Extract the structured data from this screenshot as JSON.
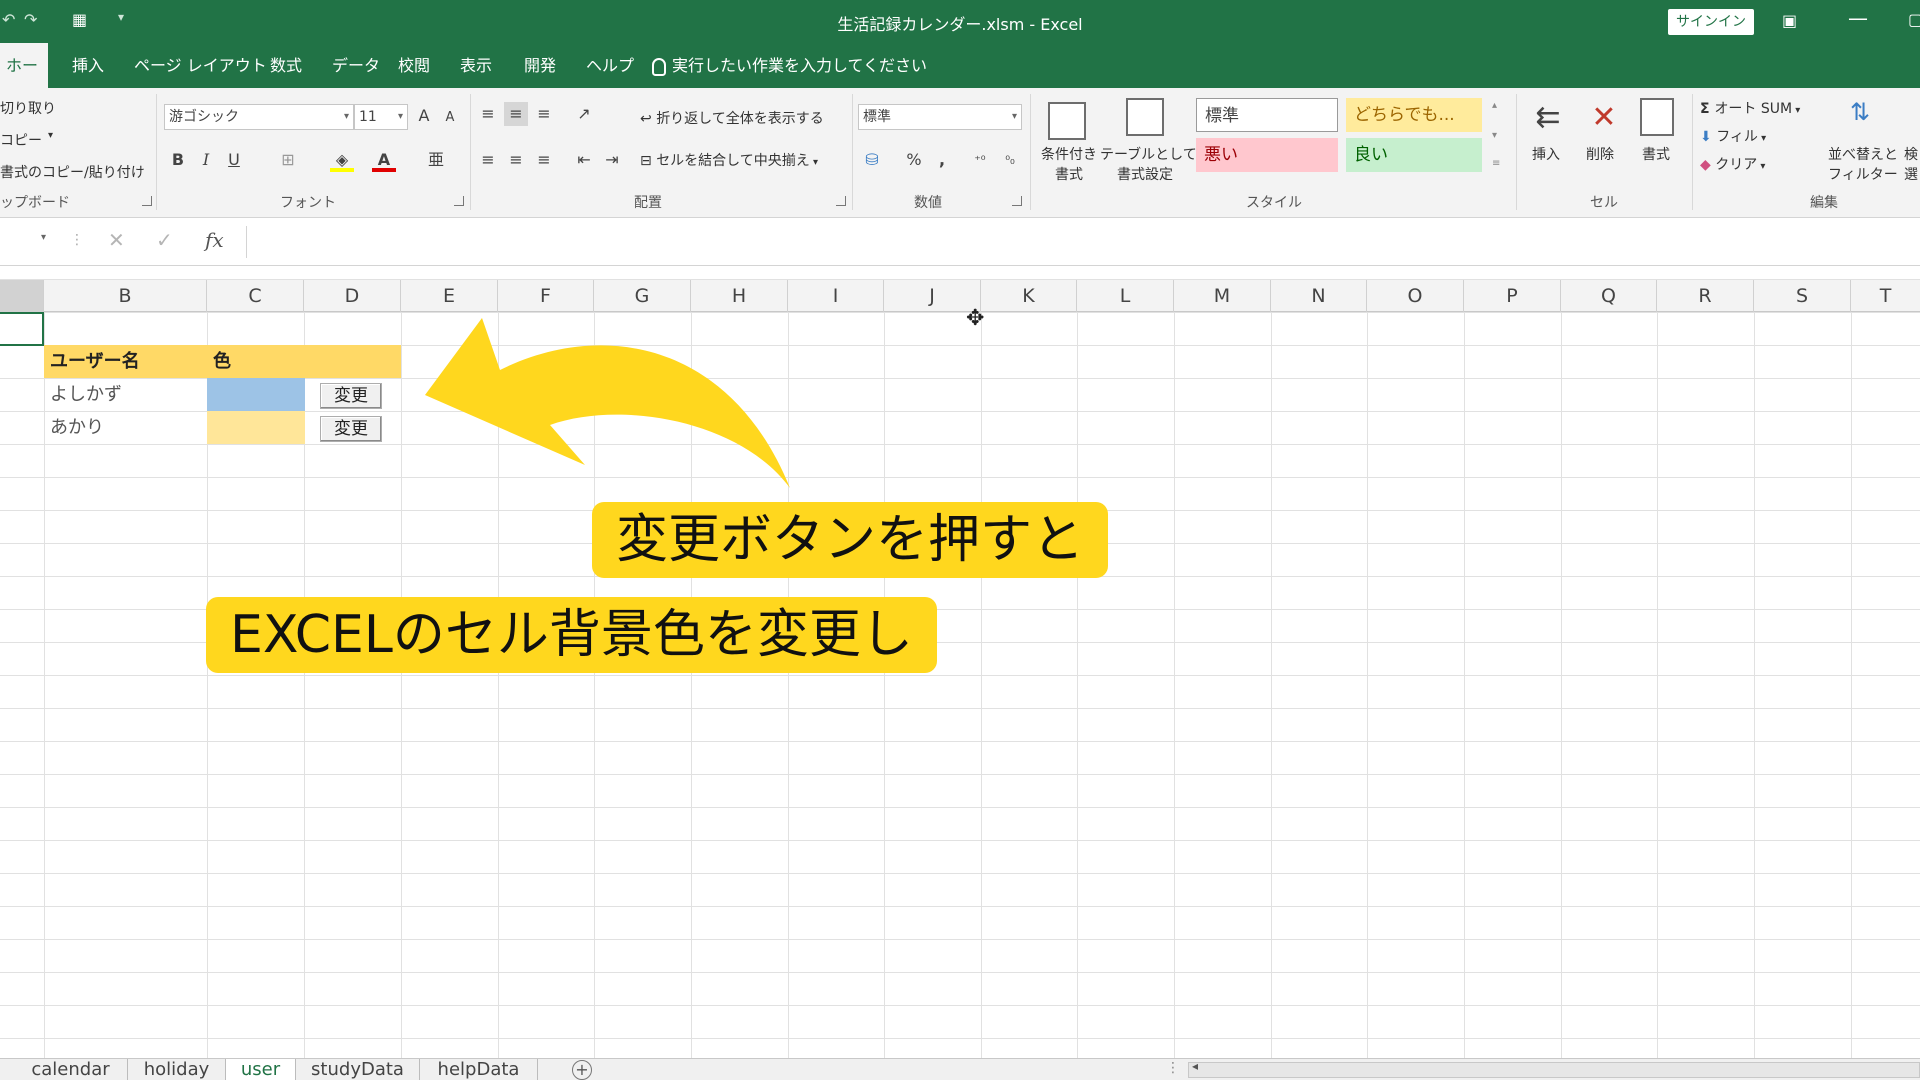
{
  "window": {
    "title": "生活記録カレンダー.xlsm  -  Excel",
    "signin": "サインイン"
  },
  "tabs": [
    {
      "label": "ホーム"
    },
    {
      "label": "挿入"
    },
    {
      "label": "ページ レイアウト"
    },
    {
      "label": "数式"
    },
    {
      "label": "データ"
    },
    {
      "label": "校閲"
    },
    {
      "label": "表示"
    },
    {
      "label": "開発"
    },
    {
      "label": "ヘルプ"
    }
  ],
  "tell_me": "実行したい作業を入力してください",
  "ribbon": {
    "clipboard": {
      "cut": "切り取り",
      "copy": "コピー",
      "format_painter": "書式のコピー/貼り付け",
      "group": "ップボード"
    },
    "font": {
      "name": "游ゴシック",
      "size": "11",
      "bold": "B",
      "italic": "I",
      "underline": "U",
      "grow": "A",
      "shrink": "A",
      "group": "フォント"
    },
    "alignment": {
      "wrap": "折り返して全体を表示する",
      "merge": "セルを結合して中央揃え",
      "group": "配置"
    },
    "number": {
      "format": "標準",
      "percent": "%",
      "comma": ",",
      "group": "数値"
    },
    "styles": {
      "conditional": "条件付き",
      "conditional2": "書式",
      "table": "テーブルとして",
      "table2": "書式設定",
      "normal": "標準",
      "neutral": "どちらでも...",
      "bad": "悪い",
      "good": "良い",
      "group": "スタイル"
    },
    "cells": {
      "insert": "挿入",
      "delete": "削除",
      "format": "書式",
      "group": "セル"
    },
    "editing": {
      "autosum": "オート SUM",
      "fill": "フィル",
      "clear": "クリア",
      "sort": "並べ替えと",
      "filter": "フィルター",
      "find": "検",
      "select": "選",
      "group": "編集"
    }
  },
  "formula_bar": {
    "fx": "fx",
    "cancel": "✕",
    "enter": "✓"
  },
  "columns": [
    "B",
    "C",
    "D",
    "E",
    "F",
    "G",
    "H",
    "I",
    "J",
    "K",
    "L",
    "M",
    "N",
    "O",
    "P",
    "Q",
    "R",
    "S",
    "T"
  ],
  "table": {
    "header": {
      "user": "ユーザー名",
      "color": "色"
    },
    "rows": [
      {
        "user": "よしかず",
        "swatch": "#9dc3e6",
        "button": "変更"
      },
      {
        "user": "あかり",
        "swatch": "#ffe699",
        "button": "変更"
      }
    ]
  },
  "annotations": {
    "callout1": "変更ボタンを押すと",
    "callout2": "EXCELのセル背景色を変更し",
    "color": "#ffd71e"
  },
  "sheets": [
    {
      "label": "calendar"
    },
    {
      "label": "holiday"
    },
    {
      "label": "user"
    },
    {
      "label": "studyData"
    },
    {
      "label": "helpData"
    }
  ],
  "colors": {
    "excel_green": "#217346",
    "header_fill": "#ffd966"
  }
}
